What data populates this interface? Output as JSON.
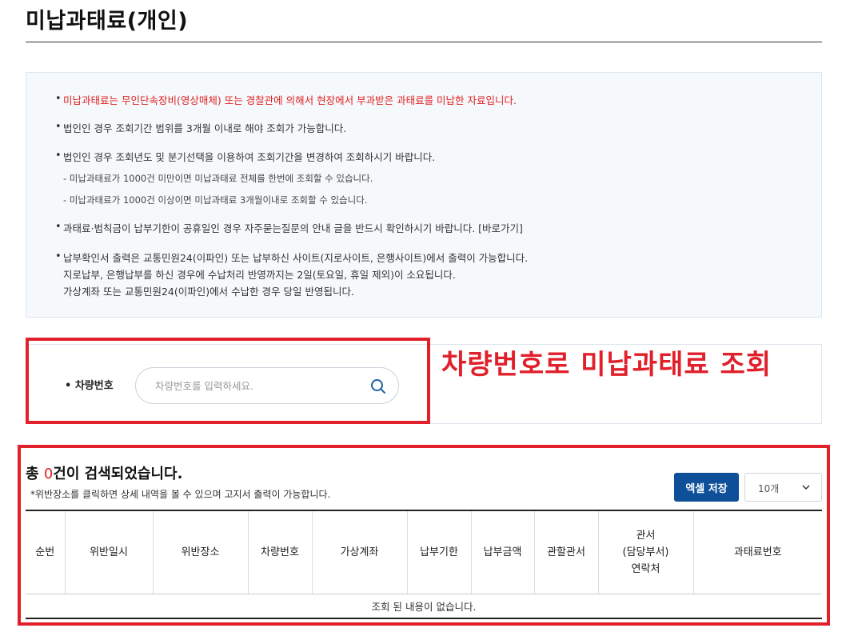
{
  "page": {
    "title": "미납과태료(개인)"
  },
  "notices": {
    "bullet": "•",
    "items": [
      "미납과태료는 무인단속장비(영상매체) 또는 경찰관에 의해서 현장에서 부과받은 과태료를 미납한 자료입니다.",
      "법인인 경우 조회기간 범위를 3개월 이내로 해야 조회가 가능합니다.",
      "법인인 경우 조회년도 및 분기선택을 이용하여 조회기간을 변경하여 조회하시기 바랍니다.",
      "과태료·범칙금이 납부기한이 공휴일인 경우 자주묻는질문의 안내 글을 반드시 확인하시기 바랍니다. [바로가기]",
      "납부확인서 출력은 교통민원24(이파인) 또는 납부하신 사이트(지로사이트, 은행사이트)에서 출력이 가능합니다."
    ],
    "sub_items": [
      "- 미납과태료가 1000건 미만이면 미납과태료 전체를 한번에 조회할 수 있습니다.",
      "- 미납과태료가 1000건 이상이면 미납과태료 3개월이내로 조회할 수 있습니다."
    ],
    "continuation": [
      "지로납부, 은행납부를 하신 경우에 수납처리 반영까지는 2일(토요일, 휴일 제외)이 소요됩니다.",
      "가상계좌 또는 교통민원24(이파인)에서 수납한 경우 당일 반영됩니다."
    ]
  },
  "search": {
    "label": "• 차량번호",
    "placeholder": "차량번호를 입력하세요.",
    "value": ""
  },
  "annotation": {
    "text": "차량번호로 미납과태료 조회",
    "color": "#e0202a"
  },
  "results": {
    "prefix": "총 ",
    "count": "0",
    "suffix": "건이 검색되었습니다.",
    "note": "*위반장소를 클릭하면 상세 내역을 볼 수 있으며 고지서 출력이 가능합니다.",
    "excel_button": "엑셀 저장",
    "page_size": "10개"
  },
  "table": {
    "columns": [
      "순번",
      "위반일시",
      "위반장소",
      "차량번호",
      "가상계좌",
      "납부기한",
      "납부금액",
      "관할관서",
      "관서\n(담당부서)\n연락처",
      "과태료번호"
    ],
    "empty_message": "조회 된 내용이 없습니다."
  },
  "colors": {
    "accent": "#0d4f98",
    "alert": "#e02020"
  }
}
